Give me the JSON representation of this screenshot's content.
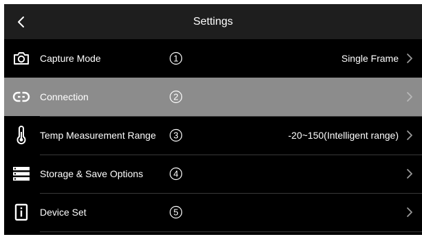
{
  "header": {
    "title": "Settings",
    "back_icon": "chevron-left-icon"
  },
  "rows": [
    {
      "label": "Capture Mode",
      "number": "1",
      "value": "Single Frame",
      "icon": "camera-icon",
      "selected": false
    },
    {
      "label": "Connection",
      "number": "2",
      "value": "",
      "icon": "link-icon",
      "selected": true
    },
    {
      "label": "Temp Measurement Range",
      "number": "3",
      "value": "-20~150(Intelligent range)",
      "icon": "thermometer-icon",
      "selected": false
    },
    {
      "label": "Storage & Save Options",
      "number": "4",
      "value": "",
      "icon": "storage-list-icon",
      "selected": false
    },
    {
      "label": "Device Set",
      "number": "5",
      "value": "",
      "icon": "device-info-icon",
      "selected": false
    }
  ],
  "colors": {
    "background": "#000000",
    "titlebar": "#1e1e1e",
    "selected_row": "#8c8c8c",
    "text": "#ffffff",
    "chevron": "#9a9a9a"
  }
}
